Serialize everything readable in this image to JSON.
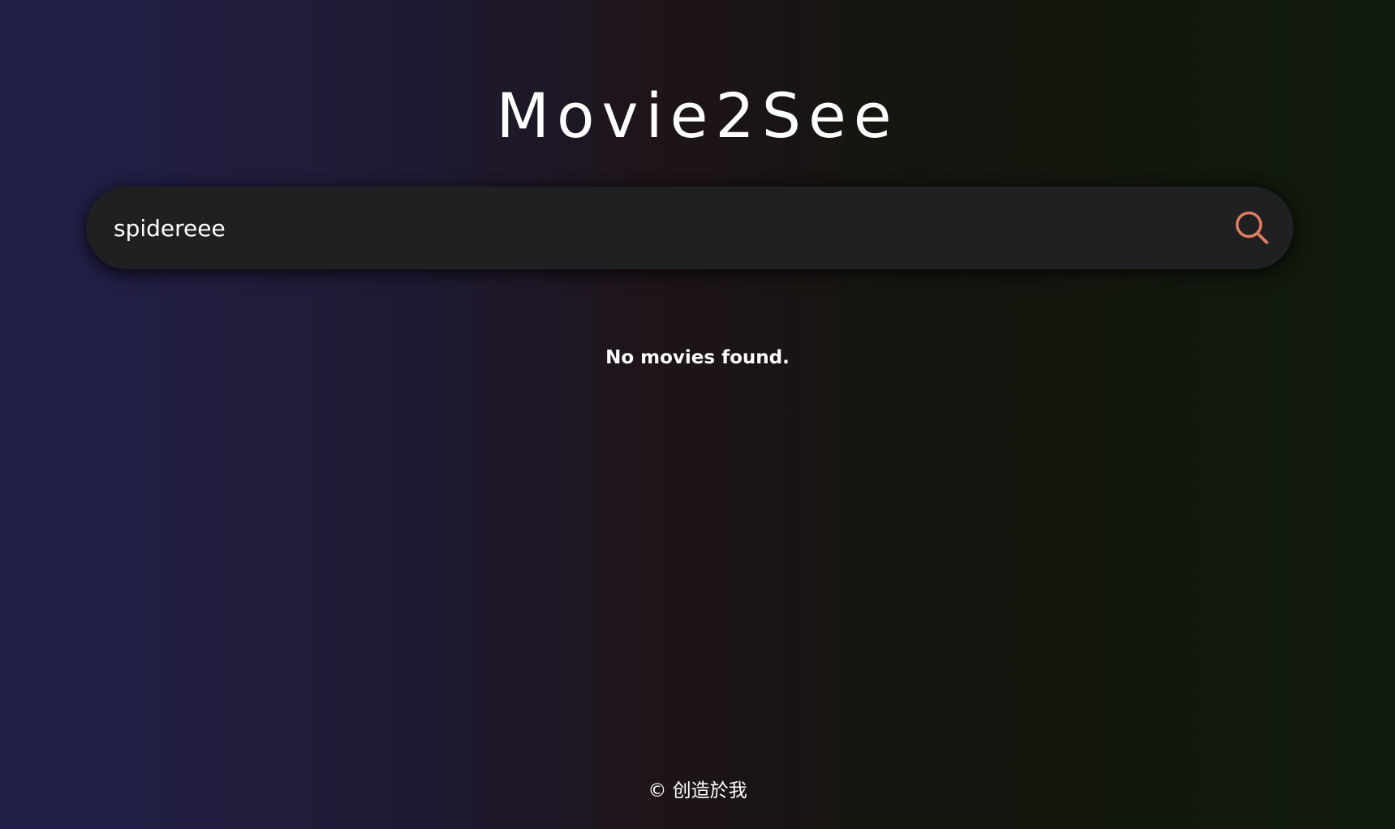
{
  "app": {
    "title": "Movie2See"
  },
  "search": {
    "value": "spidereee",
    "placeholder": "",
    "icon": "search-icon",
    "icon_color": "#e07b5f"
  },
  "results": {
    "message": "No movies found."
  },
  "footer": {
    "text": "© 创造於我"
  },
  "colors": {
    "bg_left": "#212049",
    "bg_mid": "#1e1419",
    "bg_right": "#101b0d",
    "search_bg": "#1e2022",
    "text": "#ffffff"
  }
}
